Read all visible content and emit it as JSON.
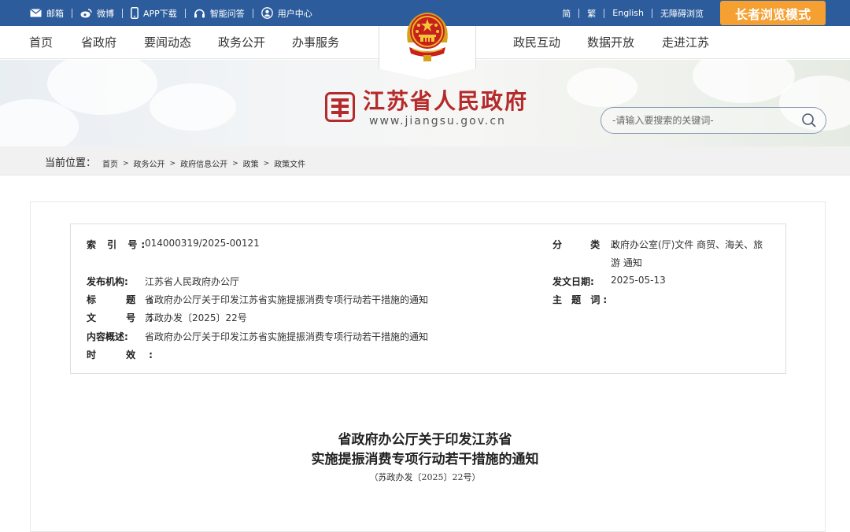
{
  "topbar": {
    "items": [
      {
        "label": "邮箱",
        "icon": "mail-icon"
      },
      {
        "label": "微博",
        "icon": "weibo-icon"
      },
      {
        "label": "APP下载",
        "icon": "phone-icon"
      },
      {
        "label": "智能问答",
        "icon": "headset-icon"
      },
      {
        "label": "用户中心",
        "icon": "user-icon"
      }
    ],
    "lang": [
      "简",
      "繁",
      "English",
      "无障碍浏览"
    ],
    "elder_mode": "长者浏览模式",
    "bg_color": "#2c5c9c",
    "accent_color": "#f5a030"
  },
  "nav": {
    "left": [
      "首页",
      "省政府",
      "要闻动态",
      "政务公开",
      "办事服务"
    ],
    "right": [
      "政民互动",
      "数据开放",
      "走进江苏"
    ]
  },
  "header": {
    "site_name": "江苏省人民政府",
    "site_url": "www.jiangsu.gov.cn",
    "search_placeholder": "-请输入要搜索的关键词-"
  },
  "breadcrumb": {
    "label": "当前位置：",
    "items": [
      "首页",
      "政务公开",
      "政府信息公开",
      "政策",
      "政策文件"
    ]
  },
  "meta": {
    "index_label": "索 引 号:",
    "index_value": "014000319/2025-00121",
    "category_label": "分 类:",
    "category_value_line1": "政府办公室(厅)文件 商贸、海关、旅",
    "category_value_line2": "游 通知",
    "publisher_label": "发布机构:",
    "publisher_value": "江苏省人民政府办公厅",
    "date_label": "发文日期:",
    "date_value": "2025-05-13",
    "title_label": "标 题:",
    "title_value": "省政府办公厅关于印发江苏省实施提振消费专项行动若干措施的通知",
    "subject_label": "主 题 词:",
    "subject_value": "",
    "docno_label": "文 号:",
    "docno_value": "苏政办发〔2025〕22号",
    "summary_label": "内容概述:",
    "summary_value": "省政府办公厅关于印发江苏省实施提振消费专项行动若干措施的通知",
    "validity_label": "时 效:",
    "validity_value": ""
  },
  "document": {
    "title_line1": "省政府办公厅关于印发江苏省",
    "title_line2": "实施提振消费专项行动若干措施的通知",
    "doc_number": "（苏政办发〔2025〕22号）"
  }
}
